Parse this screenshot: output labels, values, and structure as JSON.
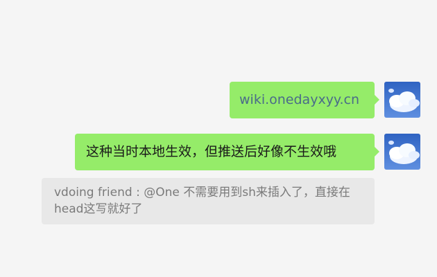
{
  "messages": [
    {
      "text": "wiki.onedayxyy.cn",
      "type": "link",
      "avatar_icon": "sky-clouds-avatar-icon"
    },
    {
      "text": "这种当时本地生效，但推送后好像不生效哦",
      "type": "text",
      "avatar_icon": "sky-clouds-avatar-icon"
    }
  ],
  "quoted_reply": {
    "text": "vdoing friend : @One 不需要用到sh来插入了，直接在head这写就好了"
  },
  "colors": {
    "background": "#f5f5f5",
    "bubble": "#95ec69",
    "link_text": "#4a6b8a",
    "reply_bg": "#e8e8e8",
    "reply_text": "#7a7a7a"
  }
}
